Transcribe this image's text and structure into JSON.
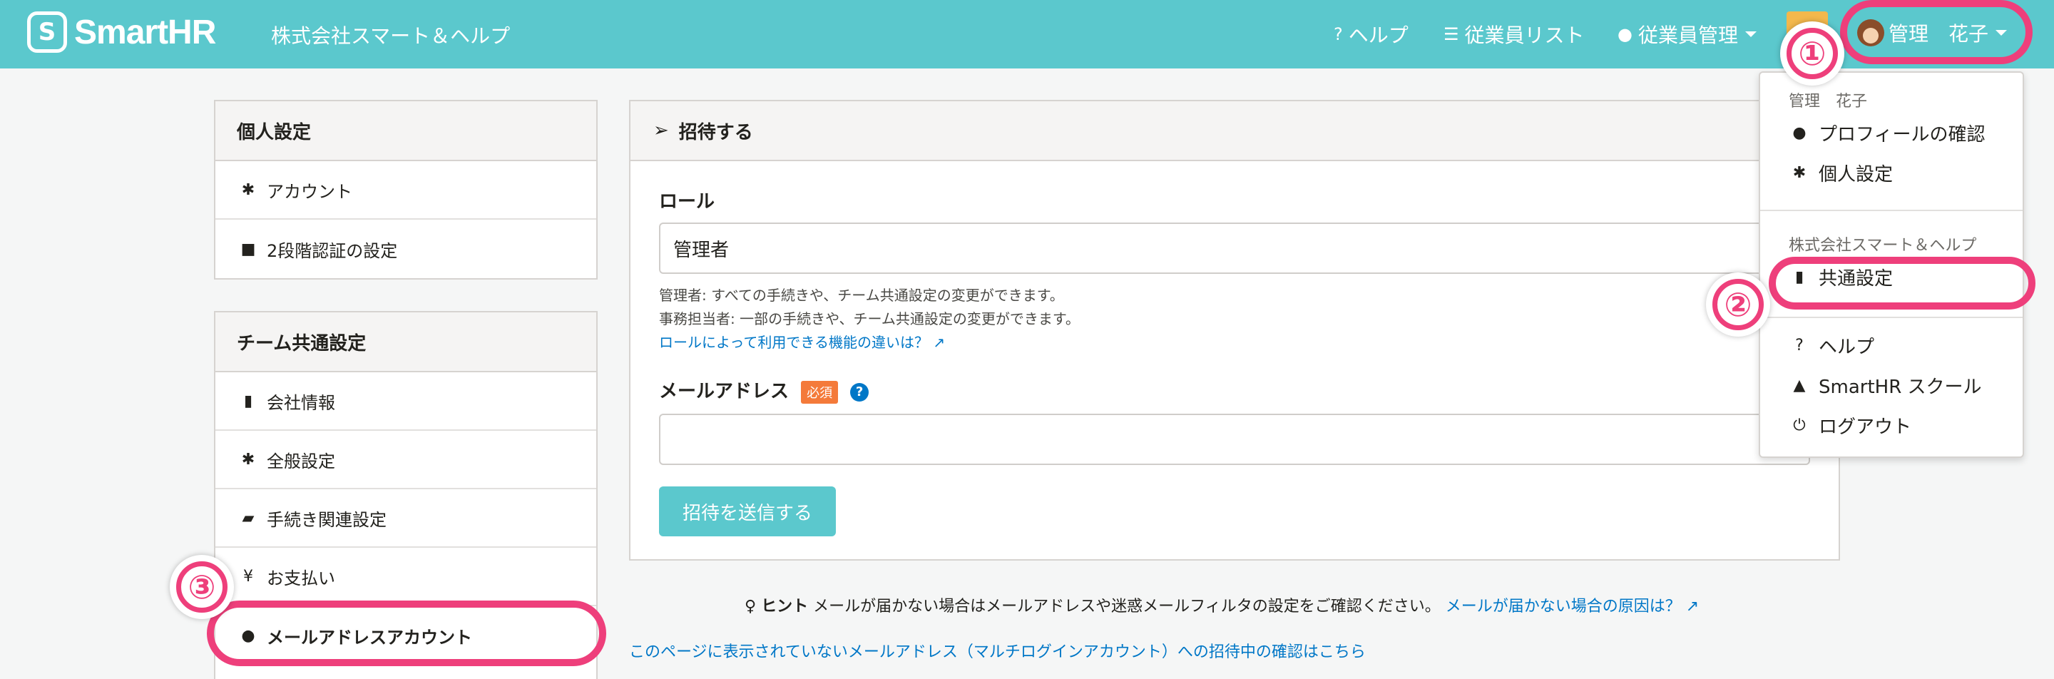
{
  "topbar": {
    "logo_text": "SmartHR",
    "company": "株式会社スマート＆ヘルプ",
    "nav_help": "ヘルプ",
    "nav_employee_list": "従業員リスト",
    "nav_employee_mgmt": "従業員管理",
    "user_name": "管理　花子"
  },
  "sidebar": {
    "personal_title": "個人設定",
    "personal_items": [
      "アカウント",
      "2段階認証の設定"
    ],
    "team_title": "チーム共通設定",
    "team_items": [
      "会社情報",
      "全般設定",
      "手続き関連設定",
      "お支払い",
      "メールアドレスアカウント"
    ]
  },
  "main": {
    "title": "招待する",
    "role_label": "ロール",
    "role_value": "管理者",
    "role_help_1": "管理者: すべての手続きや、チーム共通設定の変更ができます。",
    "role_help_2": "事務担当者: 一部の手続きや、チーム共通設定の変更ができます。",
    "role_link": "ロールによって利用できる機能の違いは？",
    "email_label": "メールアドレス",
    "required_badge": "必須",
    "email_value": "",
    "send_button": "招待を送信する"
  },
  "hint": {
    "label": "ヒント",
    "text": "メールが届かない場合はメールアドレスや迷惑メールフィルタの設定をご確認ください。",
    "link": "メールが届かない場合の原因は？"
  },
  "bottom_link": "このページに表示されていないメールアドレス（マルチログインアカウント）への招待中の確認はこちら",
  "dropdown": {
    "user_header": "管理　花子",
    "profile": "プロフィールの確認",
    "personal_settings": "個人設定",
    "company_header": "株式会社スマート＆ヘルプ",
    "common_settings": "共通設定",
    "help": "ヘルプ",
    "school": "SmartHR スクール",
    "logout": "ログアウト"
  },
  "annotations": [
    "①",
    "②",
    "③"
  ],
  "colors": {
    "topbar": "#5bc8cd",
    "highlight": "#ee3f7b",
    "link": "#0077c7",
    "required": "#f47a3a"
  }
}
